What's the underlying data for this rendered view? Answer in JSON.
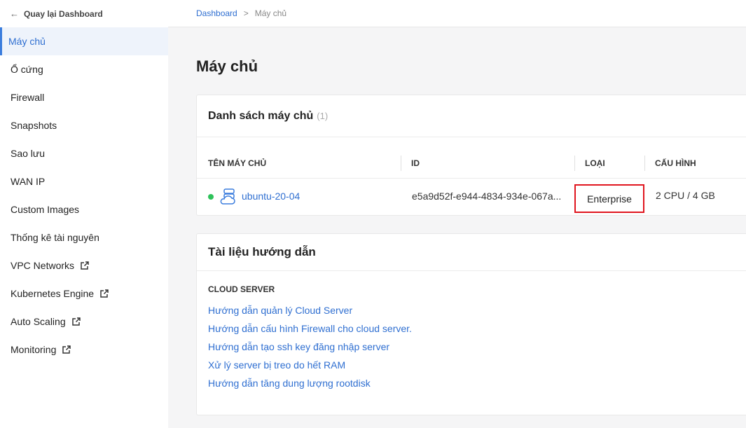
{
  "sidebar": {
    "back_label": "Quay lại Dashboard",
    "items": [
      {
        "label": "Máy chủ"
      },
      {
        "label": "Ổ cứng"
      },
      {
        "label": "Firewall"
      },
      {
        "label": "Snapshots"
      },
      {
        "label": "Sao lưu"
      },
      {
        "label": "WAN IP"
      },
      {
        "label": "Custom Images"
      },
      {
        "label": "Thống kê tài nguyên"
      },
      {
        "label": "VPC Networks"
      },
      {
        "label": "Kubernetes Engine"
      },
      {
        "label": "Auto Scaling"
      },
      {
        "label": "Monitoring"
      }
    ]
  },
  "breadcrumb": {
    "root": "Dashboard",
    "separator": ">",
    "current": "Máy chủ"
  },
  "page": {
    "title": "Máy chủ"
  },
  "servers": {
    "title": "Danh sách máy chủ",
    "count": "(1)",
    "columns": [
      "TÊN MÁY CHỦ",
      "ID",
      "LOẠI",
      "CẤU HÌNH"
    ],
    "rows": [
      {
        "status": "running",
        "name": "ubuntu-20-04",
        "id": "e5a9d52f-e944-4834-934e-067a...",
        "type": "Enterprise",
        "config": "2 CPU / 4 GB"
      }
    ]
  },
  "docs": {
    "title": "Tài liệu hướng dẫn",
    "section": "CLOUD SERVER",
    "links": [
      "Hướng dẫn quản lý Cloud Server",
      "Hướng dẫn cấu hình Firewall cho cloud server.",
      "Hướng dẫn tạo ssh key đăng nhập server",
      "Xử lý server bị treo do hết RAM",
      "Hướng dẫn tăng dung lượng rootdisk"
    ]
  },
  "colors": {
    "accent": "#2f6fd1",
    "status_running": "#2ec25a",
    "highlight_box": "#e0161f"
  }
}
